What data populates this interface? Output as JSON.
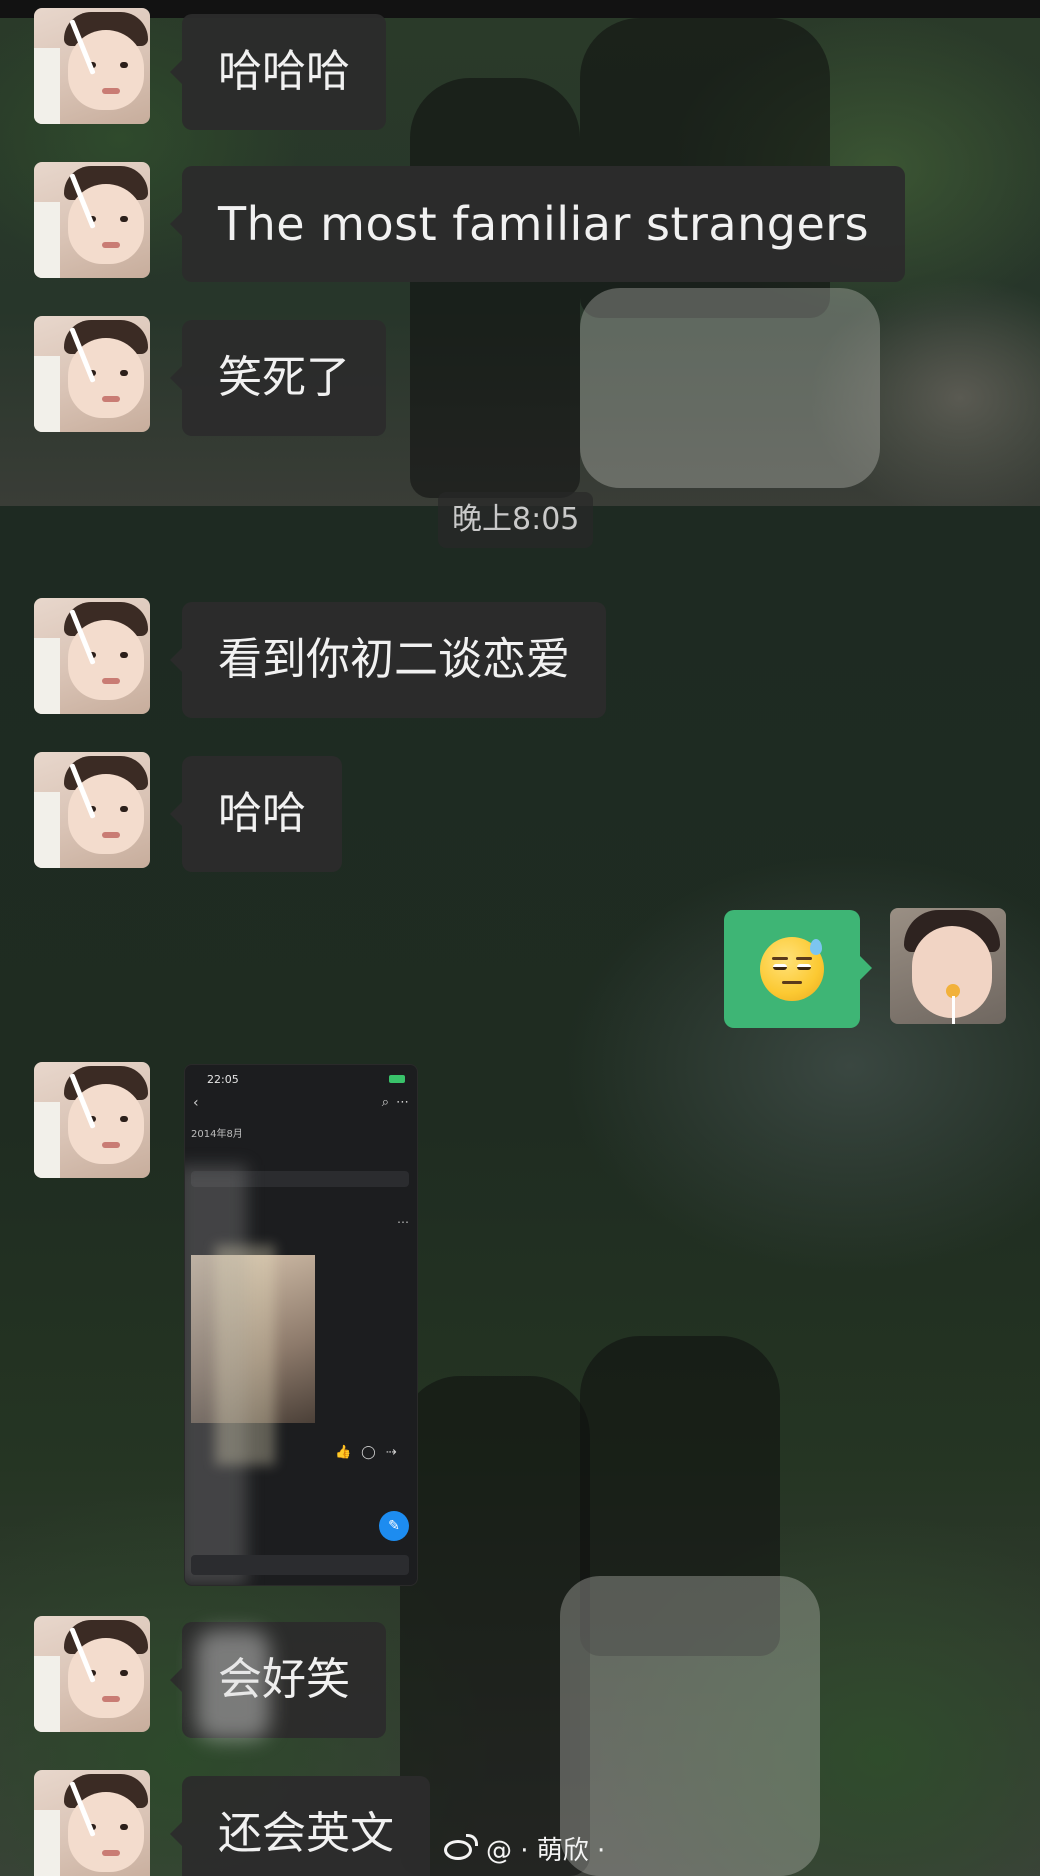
{
  "chat": {
    "messages": [
      {
        "side": "left",
        "text": "哈哈哈"
      },
      {
        "side": "left",
        "text": "The most familiar strangers"
      },
      {
        "side": "left",
        "text": "笑死了"
      },
      {
        "side": "left",
        "text": "看到你初二谈恋爱"
      },
      {
        "side": "left",
        "text": "哈哈"
      },
      {
        "side": "right",
        "emoji": "sweat-smile-emoji"
      },
      {
        "side": "left",
        "image": "screenshot-message"
      },
      {
        "side": "left",
        "text": "会好笑"
      },
      {
        "side": "left",
        "text": "还会英文"
      }
    ],
    "timestamp": "晚上8:05"
  },
  "screenshot": {
    "status_time": "22:05",
    "date_label": "2014年8月"
  },
  "watermark": {
    "text": "@ · 萌欣 ·"
  },
  "colors": {
    "bubble_left": "#2c2c2c",
    "bubble_right": "#3eb575",
    "text": "#f1f1f1"
  }
}
